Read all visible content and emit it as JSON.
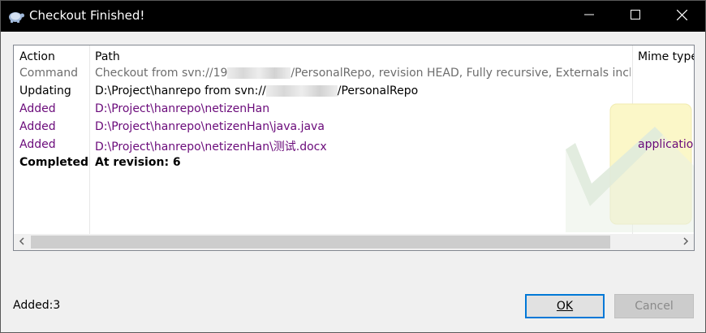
{
  "window": {
    "title": "Checkout Finished!"
  },
  "columns": {
    "action": "Action",
    "path": "Path",
    "mime": "Mime type"
  },
  "rows": [
    {
      "action": "Command",
      "path_pre": "Checkout from svn://19",
      "path_post": "/PersonalRepo, revision HEAD, Fully recursive, Externals included",
      "mime": "",
      "style": "gray"
    },
    {
      "action": "Updating",
      "path_pre": "D:\\Project\\hanrepo from svn://",
      "path_post": "/PersonalRepo",
      "mime": "",
      "style": "black"
    },
    {
      "action": "Added",
      "path": "D:\\Project\\hanrepo\\netizenHan",
      "mime": "",
      "style": "purple"
    },
    {
      "action": "Added",
      "path": "D:\\Project\\hanrepo\\netizenHan\\java.java",
      "mime": "",
      "style": "purple"
    },
    {
      "action": "Added",
      "path": "D:\\Project\\hanrepo\\netizenHan\\测试.docx",
      "mime": "application/",
      "style": "purple"
    },
    {
      "action": "Completed",
      "path": "At revision: 6",
      "mime": "",
      "style": "bold"
    }
  ],
  "status": {
    "text": "Added:3"
  },
  "buttons": {
    "ok": "OK",
    "cancel": "Cancel"
  },
  "colors": {
    "accent": "#0078d7",
    "added": "#6a0a7a",
    "command": "#6d6d6d"
  },
  "icons": {
    "app": "tortoise-icon",
    "minimize": "minimize-icon",
    "maximize": "maximize-icon",
    "close": "close-icon"
  }
}
